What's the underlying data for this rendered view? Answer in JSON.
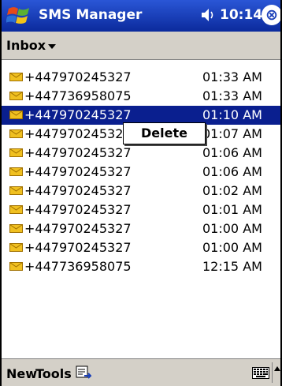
{
  "titlebar": {
    "title": "SMS Manager",
    "time": "10:14",
    "close_label": "⊗"
  },
  "folderbar": {
    "folder": "Inbox"
  },
  "messages": [
    {
      "number": "+447970245327",
      "time": "01:33 AM",
      "selected": false
    },
    {
      "number": "+447736958075",
      "time": "01:33 AM",
      "selected": false
    },
    {
      "number": "+447970245327",
      "time": "01:10 AM",
      "selected": true
    },
    {
      "number": "+447970245327",
      "time": "01:07 AM",
      "selected": false
    },
    {
      "number": "+447970245327",
      "time": "01:06 AM",
      "selected": false
    },
    {
      "number": "+447970245327",
      "time": "01:06 AM",
      "selected": false
    },
    {
      "number": "+447970245327",
      "time": "01:02 AM",
      "selected": false
    },
    {
      "number": "+447970245327",
      "time": "01:01 AM",
      "selected": false
    },
    {
      "number": "+447970245327",
      "time": "01:00 AM",
      "selected": false
    },
    {
      "number": "+447970245327",
      "time": "01:00 AM",
      "selected": false
    },
    {
      "number": "+447736958075",
      "time": "12:15 AM",
      "selected": false
    }
  ],
  "context_menu": {
    "delete_label": "Delete"
  },
  "bottombar": {
    "new_label": "New",
    "tools_label": "Tools"
  },
  "colors": {
    "titlebar": "#1a3fb8",
    "selection": "#0a1f8f",
    "bars": "#d4d0c8",
    "envelope": "#f0c020"
  }
}
